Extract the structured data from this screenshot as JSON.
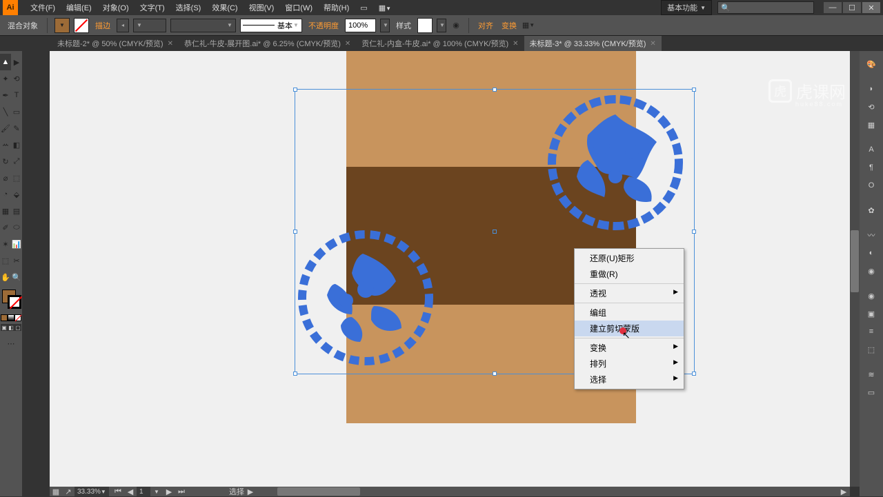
{
  "app": {
    "icon_label": "Ai"
  },
  "menu": {
    "items": [
      "文件(F)",
      "编辑(E)",
      "对象(O)",
      "文字(T)",
      "选择(S)",
      "效果(C)",
      "视图(V)",
      "窗口(W)",
      "帮助(H)"
    ],
    "workspace_label": "基本功能",
    "search_placeholder": ""
  },
  "control": {
    "left_label": "混合对象",
    "stroke_label": "描边",
    "stroke_width": "",
    "brush_preset": "基本",
    "opacity_label": "不透明度",
    "opacity_value": "100%",
    "style_label": "样式",
    "align_label": "对齐",
    "transform_label": "变换"
  },
  "tabs": [
    {
      "label": "未标题-2* @ 50% (CMYK/预览)",
      "active": false
    },
    {
      "label": "恭仁礼-牛皮-展开图.ai* @ 6.25% (CMYK/预览)",
      "active": false
    },
    {
      "label": "贡仁礼-内盒-牛皮.ai* @ 100% (CMYK/预览)",
      "active": false
    },
    {
      "label": "未标题-3* @ 33.33% (CMYK/预览)",
      "active": true
    }
  ],
  "context_menu": {
    "items": [
      {
        "label": "还原(U)矩形",
        "submenu": false,
        "hover": false
      },
      {
        "label": "重做(R)",
        "submenu": false,
        "hover": false
      },
      {
        "sep": true
      },
      {
        "label": "透视",
        "submenu": true,
        "hover": false
      },
      {
        "sep": true
      },
      {
        "label": "编组",
        "submenu": false,
        "hover": false
      },
      {
        "label": "建立剪切蒙版",
        "submenu": false,
        "hover": true
      },
      {
        "sep": true
      },
      {
        "label": "变换",
        "submenu": true,
        "hover": false
      },
      {
        "label": "排列",
        "submenu": true,
        "hover": false
      },
      {
        "label": "选择",
        "submenu": true,
        "hover": false
      }
    ]
  },
  "status": {
    "zoom": "33.33%",
    "page": "1",
    "tool": "选择"
  },
  "colors": {
    "fill": "#9c6b37",
    "artboard": "#c8945d",
    "art_dark": "#6b441f",
    "selection": "#4a8fd8"
  },
  "watermark": {
    "text": "虎课网",
    "sub": "huke88.com"
  }
}
